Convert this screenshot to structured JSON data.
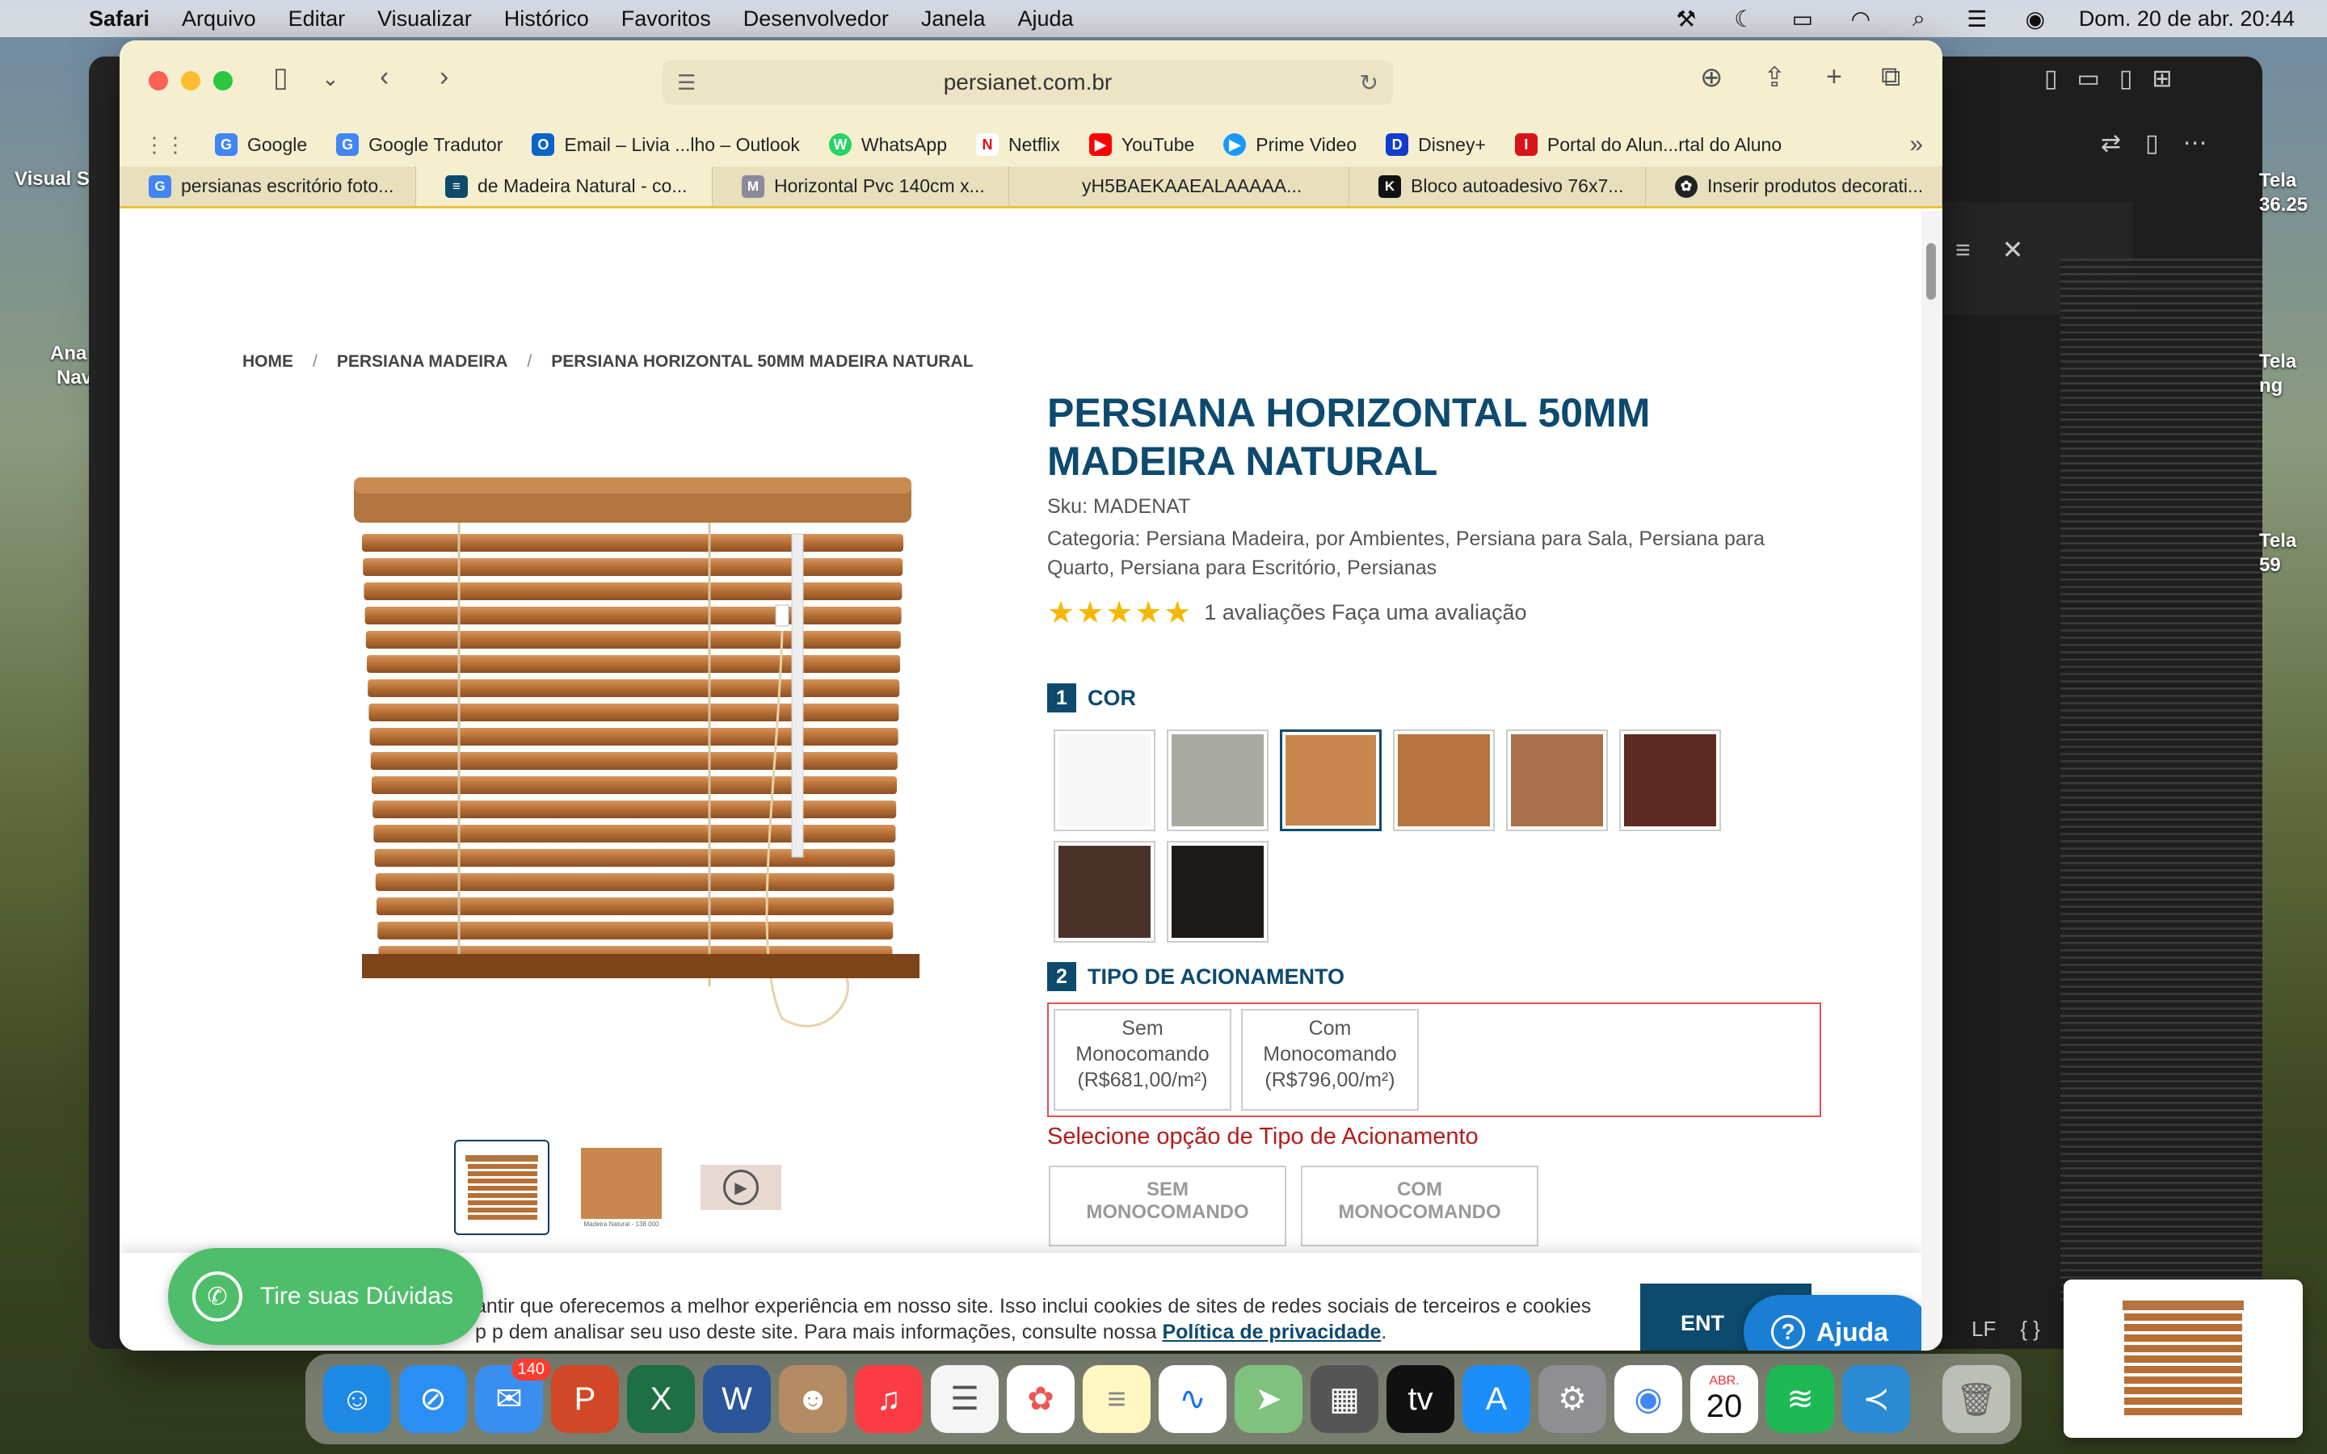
{
  "menubar": {
    "app": "Safari",
    "items": [
      "Arquivo",
      "Editar",
      "Visualizar",
      "Histórico",
      "Favoritos",
      "Desenvolvedor",
      "Janela",
      "Ajuda"
    ],
    "clock": "Dom. 20 de abr.  20:44"
  },
  "desktop": {
    "left_labels": [
      "Visual S",
      "Ana",
      "Nav"
    ],
    "right_labels": [
      "Tela",
      "36.25",
      "Tela",
      "ng",
      "Tela",
      "59"
    ]
  },
  "browser": {
    "url": "persianet.com.br",
    "favorites": [
      {
        "label": "Google",
        "icon": "google-icon",
        "color": "#4285f4",
        "glyph": "G"
      },
      {
        "label": "Google Tradutor",
        "icon": "translate-icon",
        "color": "#4285f4",
        "glyph": "G"
      },
      {
        "label": "Email – Livia ...lho – Outlook",
        "icon": "outlook-icon",
        "color": "#0a64c8",
        "glyph": "O"
      },
      {
        "label": "WhatsApp",
        "icon": "whatsapp-icon",
        "color": "#25d366",
        "glyph": "W"
      },
      {
        "label": "Netflix",
        "icon": "netflix-icon",
        "color": "#e50914",
        "glyph": "N"
      },
      {
        "label": "YouTube",
        "icon": "youtube-icon",
        "color": "#ff0000",
        "glyph": "▶"
      },
      {
        "label": "Prime Video",
        "icon": "prime-video-icon",
        "color": "#1a98ff",
        "glyph": "▶"
      },
      {
        "label": "Disney+",
        "icon": "disney-icon",
        "color": "#113ccf",
        "glyph": "D"
      },
      {
        "label": "Portal do Alun...rtal do Aluno",
        "icon": "portal-icon",
        "color": "#d7141a",
        "glyph": "I"
      }
    ],
    "tabs": [
      {
        "label": "persianas  escritório foto...",
        "icon": "google-icon",
        "color": "#4285f4",
        "glyph": "G"
      },
      {
        "label": "de Madeira Natural - co...",
        "icon": "blinds-icon",
        "color": "#0d4a6e",
        "glyph": "≡"
      },
      {
        "label": "Horizontal Pvc 140cm x...",
        "icon": "m-icon",
        "color": "#8a8a9a",
        "glyph": "M"
      },
      {
        "label": "yH5BAEKAAEALAAAAA...",
        "icon": "",
        "color": "",
        "glyph": ""
      },
      {
        "label": "Bloco autoadesivo 76x7...",
        "icon": "ka-icon",
        "color": "#111111",
        "glyph": "K"
      },
      {
        "label": "Inserir produtos decorati...",
        "icon": "openai-icon",
        "color": "#222222",
        "glyph": "✿"
      }
    ]
  },
  "page": {
    "breadcrumb": [
      "HOME",
      "PERSIANA MADEIRA",
      "PERSIANA HORIZONTAL 50MM MADEIRA NATURAL"
    ],
    "title": "PERSIANA HORIZONTAL 50MM MADEIRA NATURAL",
    "sku": "Sku: MADENAT",
    "categories": "Categoria: Persiana Madeira,  por Ambientes,  Persiana para Sala,  Persiana para Quarto,  Persiana para Escritório,  Persianas",
    "rating_stars": 5,
    "rating_text": "1 avaliações Faça uma avaliação",
    "section1": {
      "num": "1",
      "label": "COR"
    },
    "colors": [
      {
        "name": "white",
        "hex": "#f7f7f7"
      },
      {
        "name": "gray",
        "hex": "#a9aba3"
      },
      {
        "name": "natural",
        "hex": "#c8884d"
      },
      {
        "name": "light-brown",
        "hex": "#b6743f"
      },
      {
        "name": "medium-brown",
        "hex": "#a8704a"
      },
      {
        "name": "mahogany",
        "hex": "#5f2a22"
      },
      {
        "name": "dark-brown",
        "hex": "#4a3228"
      },
      {
        "name": "black",
        "hex": "#1d1a18"
      }
    ],
    "selected_color": "natural",
    "section2": {
      "num": "2",
      "label": "TIPO DE ACIONAMENTO"
    },
    "options": [
      {
        "line1": "Sem",
        "line2": "Monocomando",
        "line3": "(R$681,00/m²)"
      },
      {
        "line1": "Com",
        "line2": "Monocomando",
        "line3": "(R$796,00/m²)"
      }
    ],
    "option_error": "Selecione opção de Tipo de Acionamento",
    "option_images": [
      {
        "line1": "SEM",
        "line2": "MONOCOMANDO"
      },
      {
        "line1": "COM",
        "line2": "MONOCOMANDO"
      }
    ],
    "thumb_caption": "Madeira Natural - 138 000"
  },
  "cookie": {
    "text": "antir que oferecemos a melhor experiência em nosso site. Isso inclui cookies de sites de redes sociais de terceiros e cookies ",
    "text2": "p      p  dem analisar seu uso deste site. Para mais informações, consulte nossa ",
    "link": "Política de privacidade",
    "enter": "ENT"
  },
  "whatsapp_label": "Tire suas Dúvidas",
  "help_label": "Ajuda",
  "editor": {
    "status": [
      "LF",
      "{ }"
    ]
  },
  "dock": {
    "mail_badge": "140",
    "calendar_month": "ABR.",
    "calendar_day": "20"
  }
}
